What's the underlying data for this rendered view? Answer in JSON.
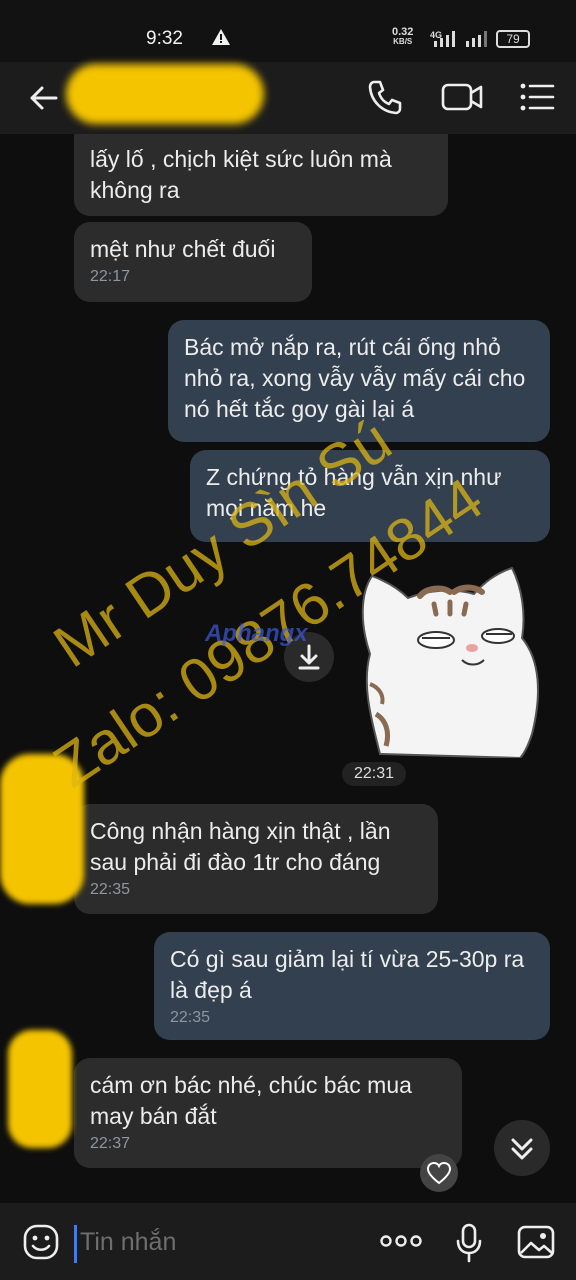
{
  "status_bar": {
    "time": "9:32",
    "net_speed_value": "0.32",
    "net_speed_unit": "KB/S",
    "network": "4G",
    "battery": "79"
  },
  "header": {
    "back_icon": "arrow-left-icon",
    "call_icon": "phone-icon",
    "video_icon": "video-camera-icon",
    "menu_icon": "list-menu-icon"
  },
  "messages": [
    {
      "side": "in",
      "text": "lấy lố , chịch kiệt sức luôn mà không ra",
      "time": ""
    },
    {
      "side": "in",
      "text": "mệt như chết đuối",
      "time": "22:17"
    },
    {
      "side": "out",
      "text": "Bác mở nắp ra, rút cái ống nhỏ nhỏ ra, xong vẫy vẫy mấy cái cho nó hết tắc goy gài lại á",
      "time": ""
    },
    {
      "side": "out",
      "text": "Z chứng tỏ hàng vẫn xịn như mọi năm he",
      "time": ""
    },
    {
      "side": "in",
      "text": "Công nhận hàng xịn thật , lần sau phải đi đào 1tr cho đáng",
      "time": "22:35"
    },
    {
      "side": "out",
      "text": "Có gì sau giảm lại tí vừa 25-30p ra là đẹp á",
      "time": "22:35"
    },
    {
      "side": "in",
      "text": "cám ơn bác nhé, chúc bác mua may bán đắt",
      "time": "22:37"
    }
  ],
  "sticker": {
    "time": "22:31",
    "download_icon": "download-icon",
    "image": "cat-sticker"
  },
  "watermark": {
    "line1": "Mr Duy Sìn Sú",
    "line2": "Zalo: 09876.74844",
    "logo": "Aphangx"
  },
  "input": {
    "placeholder": "Tin nhắn",
    "emoji_icon": "emoji-icon",
    "more_icon": "more-dots-icon",
    "mic_icon": "microphone-icon",
    "image_icon": "image-icon"
  },
  "floating": {
    "scroll_icon": "chevron-double-down-icon",
    "react_icon": "heart-icon"
  }
}
